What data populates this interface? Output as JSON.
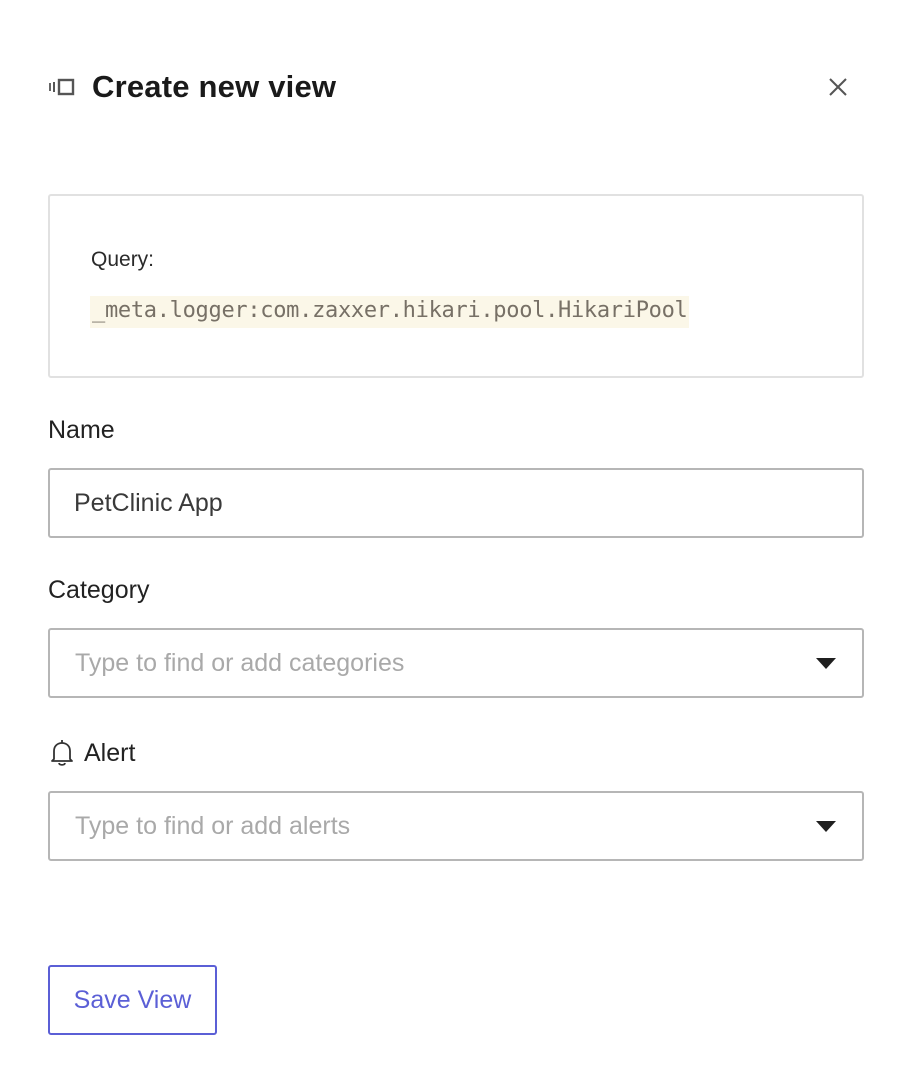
{
  "dialog": {
    "title": "Create new view",
    "header_icon": "view-icon",
    "close_icon": "close-icon"
  },
  "query": {
    "label": "Query:",
    "value": "_meta.logger:com.zaxxer.hikari.pool.HikariPool"
  },
  "name_field": {
    "label": "Name",
    "value": "PetClinic App"
  },
  "category_field": {
    "label": "Category",
    "placeholder": "Type to find or add categories",
    "dropdown_icon": "caret-down-icon"
  },
  "alert_field": {
    "label": "Alert",
    "label_icon": "bell-icon",
    "placeholder": "Type to find or add alerts",
    "dropdown_icon": "caret-down-icon"
  },
  "actions": {
    "save_label": "Save View"
  },
  "colors": {
    "accent": "#5b5fd6",
    "query_highlight": "#fbf7e8",
    "border": "#b6b6b6"
  }
}
